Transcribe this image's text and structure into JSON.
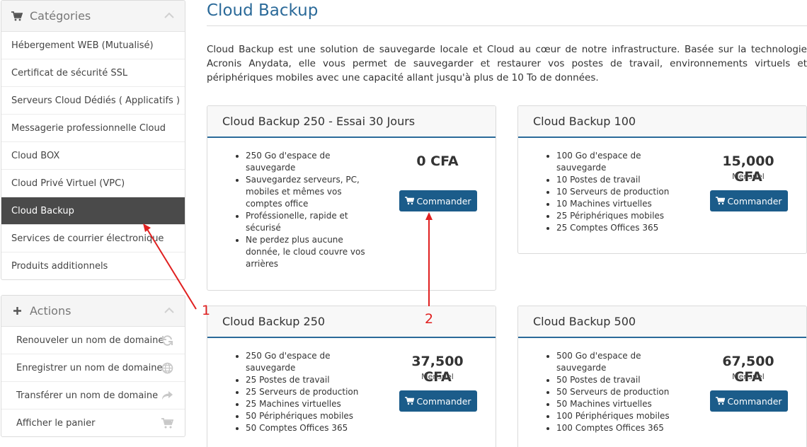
{
  "sidebar": {
    "categories": {
      "title": "Catégories",
      "items": [
        {
          "label": "Hébergement WEB (Mutualisé)"
        },
        {
          "label": "Certificat de sécurité SSL"
        },
        {
          "label": "Serveurs Cloud Dédiés ( Applicatifs )"
        },
        {
          "label": "Messagerie professionnelle Cloud"
        },
        {
          "label": "Cloud BOX"
        },
        {
          "label": "Cloud Privé Virtuel (VPC)"
        },
        {
          "label": "Cloud Backup"
        },
        {
          "label": "Services de courrier électronique"
        },
        {
          "label": "Produits additionnels"
        }
      ],
      "active_index": 6
    },
    "actions": {
      "title": "Actions",
      "items": [
        {
          "label": "Renouveler un nom de domaine",
          "icon": "refresh-icon"
        },
        {
          "label": "Enregistrer un nom de domaine",
          "icon": "globe-icon"
        },
        {
          "label": "Transférer un nom de domaine",
          "icon": "share-arrow-icon"
        },
        {
          "label": "Afficher le panier",
          "icon": "cart-icon"
        }
      ]
    }
  },
  "main": {
    "title": "Cloud Backup",
    "intro": "Cloud Backup est une solution de sauvegarde locale et Cloud au cœur de notre infrastructure. Basée sur la technologie Acronis Anydata, elle vous permet de sauvegarder et restaurer vos postes de travail, environnements virtuels et périphériques mobiles avec une capacité allant jusqu'à plus de 10 To de données.",
    "products": [
      {
        "name": "Cloud Backup 250 - Essai 30 Jours",
        "features": [
          "250 Go d'espace de sauvegarde",
          "Sauvegardez serveurs, PC, mobiles et mêmes vos comptes office",
          "Proféssionelle, rapide et sécurisé",
          "Ne perdez plus aucune donnée, le cloud couvre vos arrières"
        ],
        "price": "0 CFA",
        "period": "",
        "button": "Commander"
      },
      {
        "name": "Cloud Backup 100",
        "features": [
          "100 Go d'espace de sauvegarde",
          "10 Postes de travail",
          "10 Serveurs de production",
          "10 Machines virtuelles",
          "25 Périphériques mobiles",
          "25 Comptes Offices 365"
        ],
        "price": "15,000 CFA",
        "period": "Mensuel",
        "button": "Commander"
      },
      {
        "name": "Cloud Backup 250",
        "features": [
          "250 Go d'espace de sauvegarde",
          "25 Postes de travail",
          "25 Serveurs de production",
          "25 Machines virtuelles",
          "50 Périphériques mobiles",
          "50 Comptes Offices 365"
        ],
        "price": "37,500 CFA",
        "period": "Mensuel",
        "button": "Commander"
      },
      {
        "name": "Cloud Backup 500",
        "features": [
          "500 Go d'espace de sauvegarde",
          "50 Postes de travail",
          "50 Serveurs de production",
          "50 Machines virtuelles",
          "100 Périphériques mobiles",
          "100 Comptes Offices 365"
        ],
        "price": "67,500 CFA",
        "period": "Mensuel",
        "button": "Commander"
      }
    ]
  },
  "annotations": [
    {
      "label": "1"
    },
    {
      "label": "2"
    }
  ],
  "colors": {
    "accent": "#2b6a99",
    "button": "#1b5c8a",
    "active_menu": "#4a4a4a",
    "annotation": "#e02020"
  }
}
